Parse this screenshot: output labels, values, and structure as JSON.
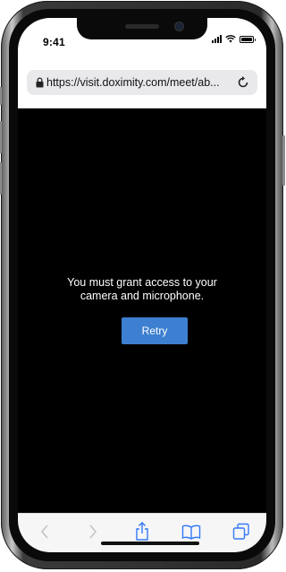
{
  "status": {
    "time": "9:41"
  },
  "browser": {
    "url": "https://visit.doximity.com/meet/ab..."
  },
  "main": {
    "message_line1": "You must grant access to your",
    "message_line2": "camera and microphone.",
    "retry_label": "Retry",
    "retry_color": "#3d7fd0"
  },
  "toolbar": {
    "items": [
      "back-icon",
      "forward-icon",
      "share-icon",
      "bookmarks-icon",
      "tabs-icon"
    ]
  }
}
